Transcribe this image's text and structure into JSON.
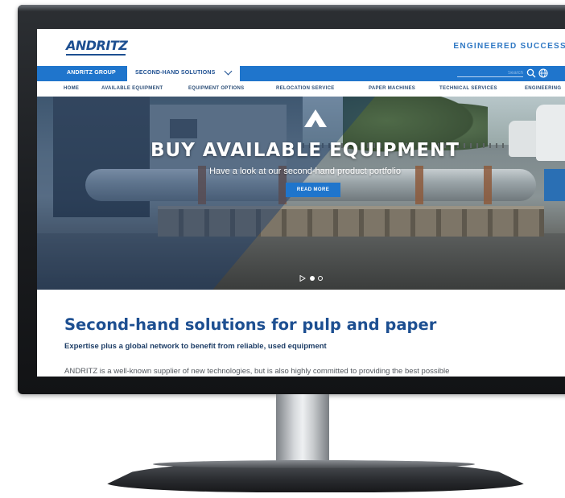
{
  "header": {
    "logo_text": "ANDRITZ",
    "tagline": "ENGINEERED SUCCESS"
  },
  "navbar": {
    "group_label": "ANDRITZ GROUP",
    "active_label": "SECOND-HAND SOLUTIONS",
    "search_placeholder": "Search"
  },
  "subnav": {
    "items": [
      "HOME",
      "AVAILABLE EQUIPMENT",
      "EQUIPMENT OPTIONS",
      "RELOCATION SERVICE",
      "PAPER MACHINES",
      "TECHNICAL SERVICES",
      "ENGINEERING"
    ]
  },
  "hero": {
    "title": "BUY AVAILABLE EQUIPMENT",
    "subtitle": "Have a look at our second-hand product portfolio",
    "button_label": "READ MORE",
    "slide_count": 2,
    "active_slide": 1
  },
  "content": {
    "heading": "Second-hand solutions for pulp and paper",
    "subheading": "Expertise plus a global network to benefit from reliable, used equipment",
    "body": "ANDRITZ is a well-known supplier of new technologies, but is also highly committed to providing the best possible"
  },
  "icons": {
    "search": "search-icon",
    "globe": "globe-icon",
    "chevron": "chevron-down-icon",
    "play": "play-icon"
  },
  "colors": {
    "brand_blue": "#1d4f91",
    "nav_blue": "#1f75cc",
    "accent_light_blue": "#2f78c4"
  }
}
